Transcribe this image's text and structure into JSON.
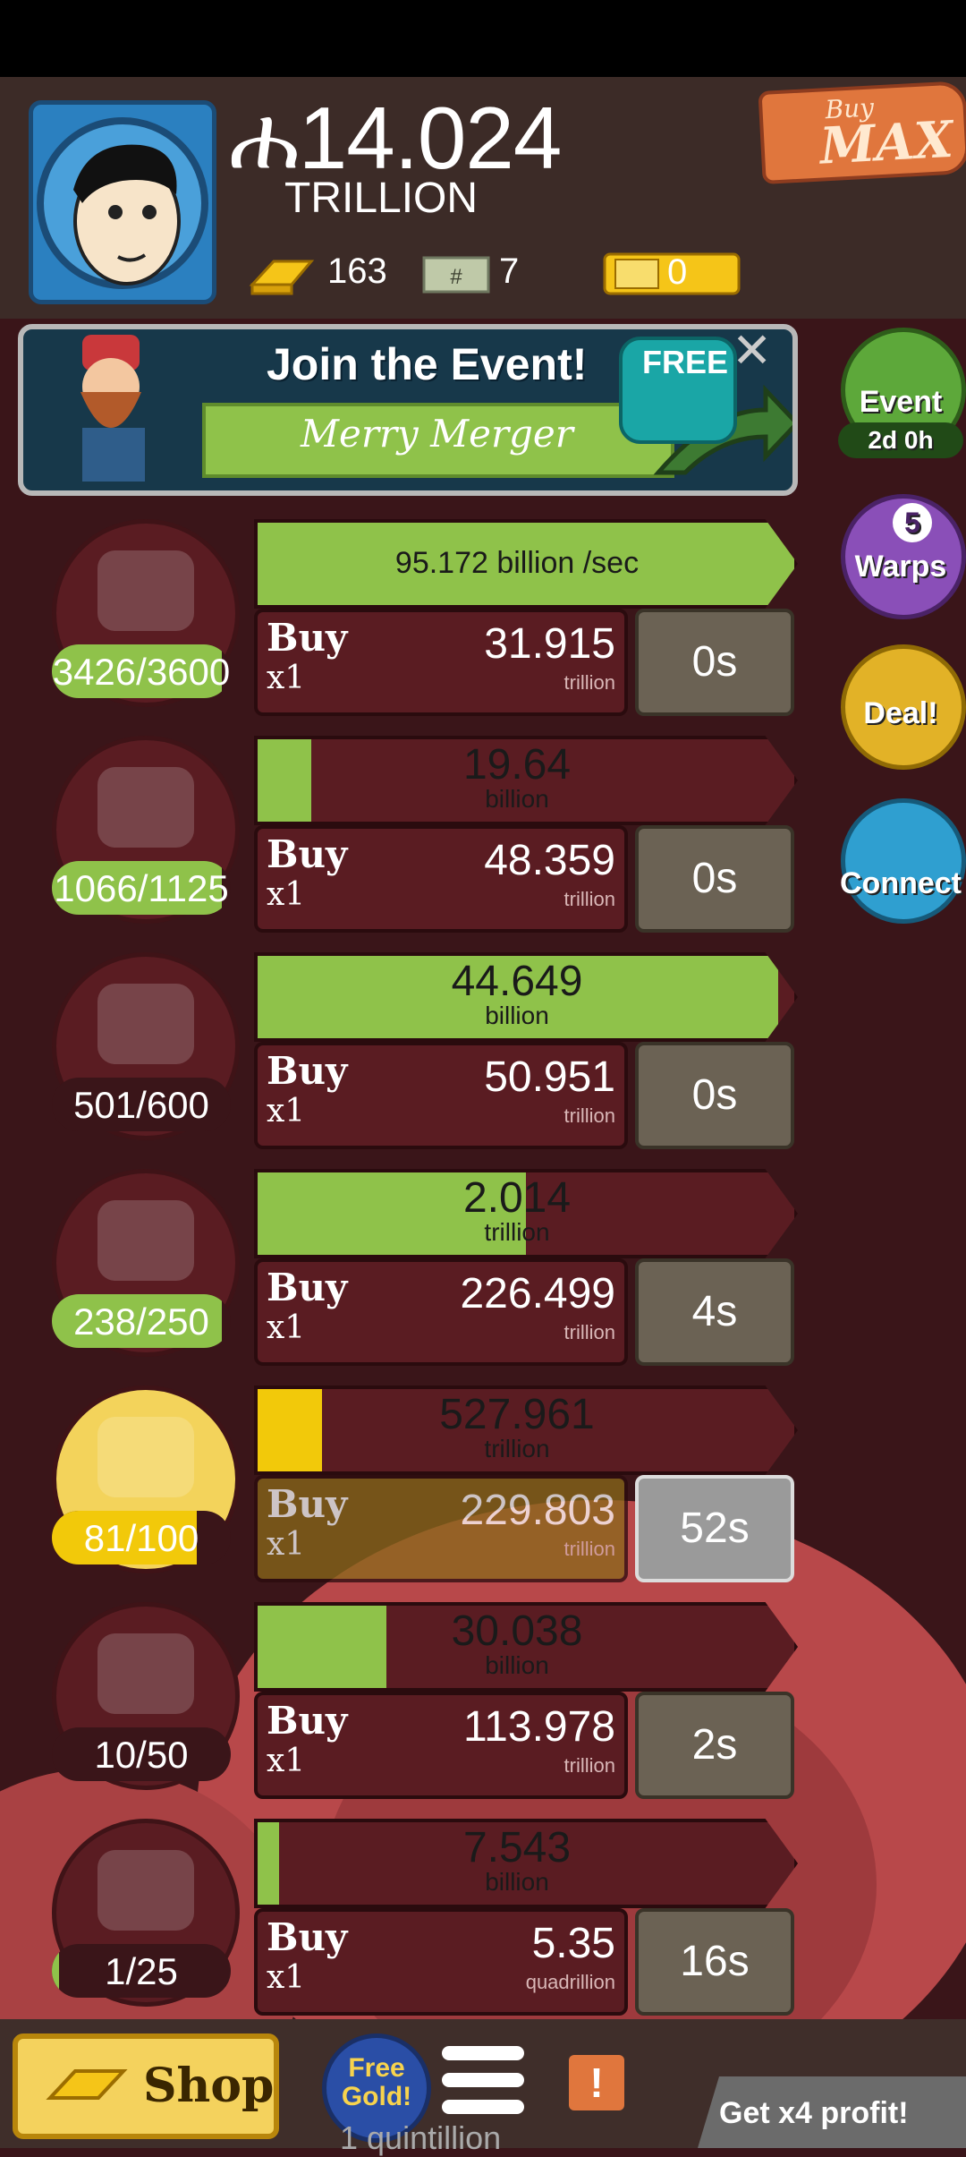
{
  "header": {
    "money_value": "ሐ14.024",
    "money_unit": "TRILLION",
    "gold_count": "163",
    "megaticket_count": "7",
    "ticket_count": "0",
    "buy_small": "Buy",
    "buy_big": "MAX"
  },
  "banner": {
    "title": "Join the Event!",
    "subtitle": "Merry Merger",
    "free_label": "FREE",
    "close_icon": "close-icon"
  },
  "side": {
    "event_label": "Event",
    "event_time": "2d 0h",
    "warps_count": "5",
    "warps_label": "Warps",
    "deal_label": "Deal!",
    "connect_label": "Connect"
  },
  "businesses": [
    {
      "count": "3426/3600",
      "count_fill": 0.95,
      "bar_text": "95.172 billion /sec",
      "bar_unit": "",
      "bar_fill": 1.0,
      "bar_color": "#8fc24a",
      "buy_label": "Buy",
      "buy_mult": "x1",
      "price": "31.915",
      "price_unit": "trillion",
      "timer": "0s",
      "icon": "rocks-icon",
      "circle": "#5a1c22",
      "pill": "#8fc24a"
    },
    {
      "count": "1066/1125",
      "count_fill": 0.95,
      "bar_text": "19.64",
      "bar_unit": "billion",
      "bar_fill": 0.1,
      "bar_color": "#8fc24a",
      "buy_label": "Buy",
      "buy_mult": "x1",
      "price": "48.359",
      "price_unit": "trillion",
      "timer": "0s",
      "icon": "chocolate-icon",
      "circle": "#5a1c22",
      "pill": "#8fc24a"
    },
    {
      "count": "501/600",
      "count_fill": 0.0,
      "bar_text": "44.649",
      "bar_unit": "billion",
      "bar_fill": 0.97,
      "bar_color": "#8fc24a",
      "buy_label": "Buy",
      "buy_mult": "x1",
      "price": "50.951",
      "price_unit": "trillion",
      "timer": "0s",
      "icon": "man-face-icon",
      "circle": "#5a1c22",
      "pill": "#8fc24a"
    },
    {
      "count": "238/250",
      "count_fill": 0.95,
      "bar_text": "2.014",
      "bar_unit": "trillion",
      "bar_fill": 0.5,
      "bar_color": "#8fc24a",
      "buy_label": "Buy",
      "buy_mult": "x1",
      "price": "226.499",
      "price_unit": "trillion",
      "timer": "4s",
      "icon": "robot-bug-icon",
      "circle": "#5a1c22",
      "pill": "#8fc24a"
    },
    {
      "count": "81/100",
      "count_fill": 0.81,
      "bar_text": "527.961",
      "bar_unit": "trillion",
      "bar_fill": 0.12,
      "bar_color": "#f2c90a",
      "buy_label": "Buy",
      "buy_mult": "x1",
      "price": "229.803",
      "price_unit": "trillion",
      "timer": "52s",
      "icon": "dollar-portal-icon",
      "circle": "#f3d35b",
      "pill": "#f2c90a"
    },
    {
      "count": "10/50",
      "count_fill": 0.0,
      "bar_text": "30.038",
      "bar_unit": "billion",
      "bar_fill": 0.24,
      "bar_color": "#8fc24a",
      "buy_label": "Buy",
      "buy_mult": "x1",
      "price": "113.978",
      "price_unit": "trillion",
      "timer": "2s",
      "icon": "astronaut-alien-icon",
      "circle": "#5a1c22",
      "pill": "#8fc24a"
    },
    {
      "count": "1/25",
      "count_fill": 0.04,
      "bar_text": "7.543",
      "bar_unit": "billion",
      "bar_fill": 0.04,
      "bar_color": "#8fc24a",
      "buy_label": "Buy",
      "buy_mult": "x1",
      "price": "5.35",
      "price_unit": "quadrillion",
      "timer": "16s",
      "icon": "brain-sunglasses-icon",
      "circle": "#5a1c22",
      "pill": "#8fc24a"
    }
  ],
  "bottom": {
    "shop_label": "Shop",
    "free_gold_label": "Free Gold!",
    "get_x4_label": "Get x4 profit!",
    "under_text": "1 quintillion"
  }
}
